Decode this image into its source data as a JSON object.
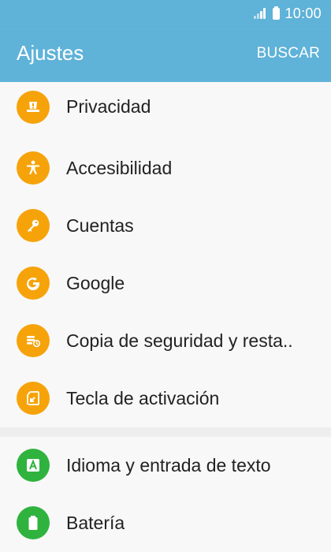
{
  "status_bar": {
    "time": "10:00"
  },
  "app_bar": {
    "title": "Ajustes",
    "action": "BUSCAR"
  },
  "colors": {
    "app_bar": "#5fb2d8",
    "orange_icon": "#f6a30a",
    "green_icon": "#2fb33e"
  },
  "settings": {
    "group1": [
      {
        "label": "Privacidad",
        "icon": "privacy-badge-icon"
      },
      {
        "label": "Accesibilidad",
        "icon": "accessibility-person-icon"
      },
      {
        "label": "Cuentas",
        "icon": "key-icon"
      },
      {
        "label": "Google",
        "icon": "google-g-icon"
      },
      {
        "label": "Copia de seguridad y resta..",
        "icon": "backup-restore-icon"
      },
      {
        "label": "Tecla de activación",
        "icon": "activation-key-icon"
      }
    ],
    "group2": [
      {
        "label": "Idioma y entrada de texto",
        "icon": "language-a-icon"
      },
      {
        "label": "Batería",
        "icon": "battery-icon"
      }
    ]
  }
}
